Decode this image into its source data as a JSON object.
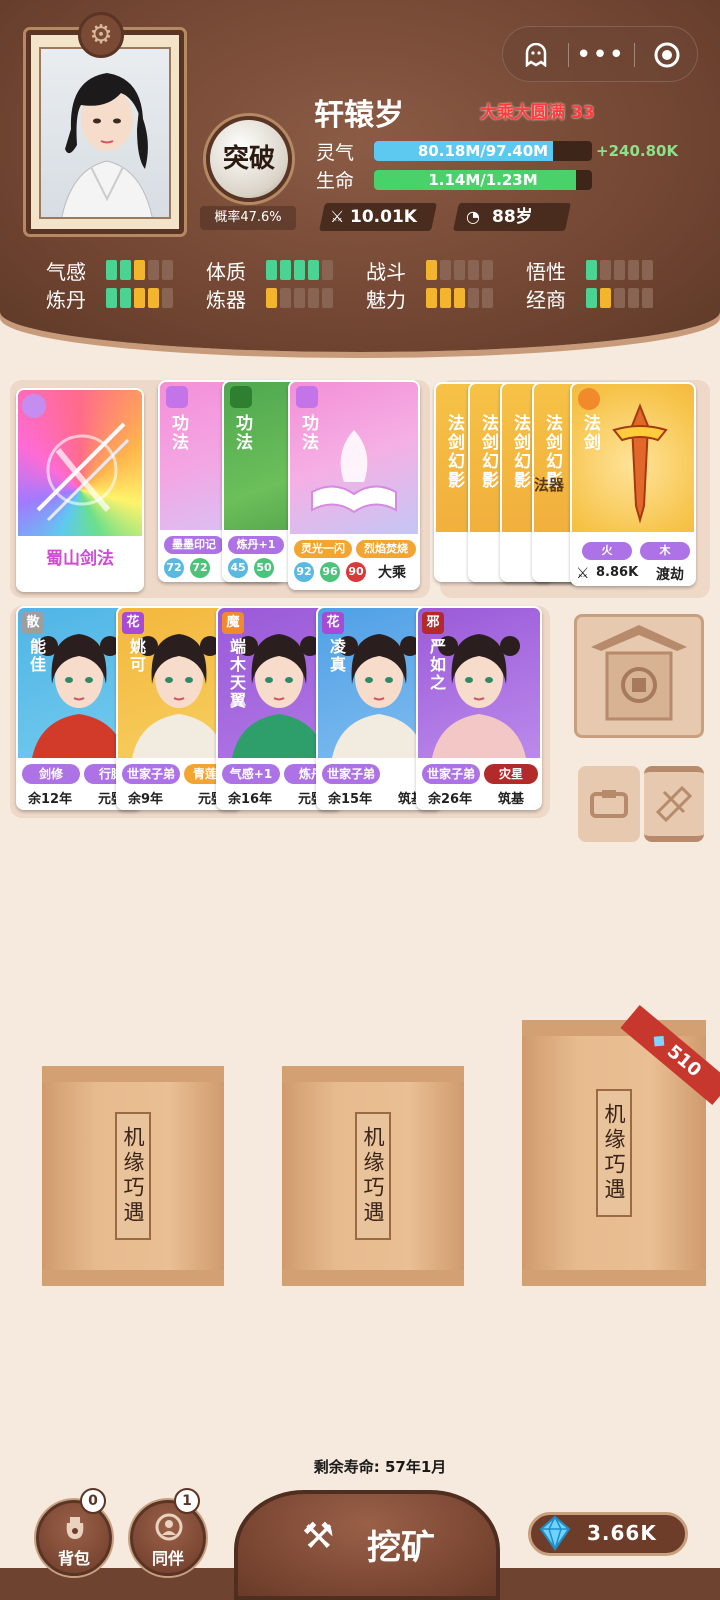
{
  "header": {
    "character_name": "轩辕岁",
    "realm": "大乘大圆满 33",
    "breakthrough_label": "突破",
    "breakthrough_rate": "概率47.6%",
    "qi": {
      "label": "灵气",
      "value": "80.18M/97.40M",
      "rate": "+240.80K",
      "fill": 0.823
    },
    "hp": {
      "label": "生命",
      "value": "1.14M/1.23M",
      "fill": 0.927
    },
    "power": "10.01K",
    "age": "88岁",
    "attributes": [
      {
        "label": "气感",
        "levels": [
          "#4bd394",
          "#4bd394",
          "#f4b52e",
          "#8a6452",
          "#8a6452"
        ]
      },
      {
        "label": "体质",
        "levels": [
          "#4bd394",
          "#4bd394",
          "#4bd394",
          "#4bd394",
          "#8a6452"
        ]
      },
      {
        "label": "战斗",
        "levels": [
          "#f4b52e",
          "#8a6452",
          "#8a6452",
          "#8a6452",
          "#8a6452"
        ]
      },
      {
        "label": "悟性",
        "levels": [
          "#4bd394",
          "#8a6452",
          "#8a6452",
          "#8a6452",
          "#8a6452"
        ]
      },
      {
        "label": "炼丹",
        "levels": [
          "#4bd394",
          "#4bd394",
          "#f4b52e",
          "#f4b52e",
          "#8a6452"
        ]
      },
      {
        "label": "炼器",
        "levels": [
          "#f4b52e",
          "#8a6452",
          "#8a6452",
          "#8a6452",
          "#8a6452"
        ]
      },
      {
        "label": "魅力",
        "levels": [
          "#f4b52e",
          "#f4b52e",
          "#f4b52e",
          "#8a6452",
          "#8a6452"
        ]
      },
      {
        "label": "经商",
        "levels": [
          "#4bd394",
          "#f4b52e",
          "#8a6452",
          "#8a6452",
          "#8a6452"
        ]
      }
    ]
  },
  "top_cards": {
    "sword_skill": {
      "name": "蜀山剑法"
    },
    "techniques": [
      {
        "type": "功法",
        "tag": "墨墨印记",
        "nums": [
          "72",
          "72"
        ]
      },
      {
        "type": "功法",
        "tag": "炼丹+1",
        "nums": [
          "45",
          "50"
        ]
      },
      {
        "type": "功法",
        "tag": "灵光一闪",
        "tag2": "烈焰焚烧",
        "nums": [
          "92",
          "96",
          "90"
        ],
        "realm": "大乘"
      }
    ],
    "artifacts": [
      {
        "type": "法剑幻影"
      },
      {
        "type": "法剑幻影"
      },
      {
        "type": "法剑幻影"
      },
      {
        "type": "法剑幻影",
        "overlay": "法器"
      },
      {
        "type": "法剑",
        "element1": "火",
        "element2": "木",
        "power": "8.86K",
        "stage": "渡劫"
      }
    ],
    "artifact_partial_power": "8",
    "artifact_partial_element": "火"
  },
  "companions": [
    {
      "badge": "散",
      "name": "能佳",
      "tag1": "剑修",
      "tag2": "行脚",
      "life": "余12年",
      "stage": "元婴"
    },
    {
      "badge": "花",
      "name": "姚可",
      "tag1": "世家子弟",
      "tag2": "青莲剑",
      "life": "余9年",
      "stage": "元婴"
    },
    {
      "badge": "魔",
      "name": "端木天翼",
      "tag1": "气感+1",
      "tag2": "炼丹",
      "life": "余16年",
      "stage": "元婴"
    },
    {
      "badge": "花",
      "name": "凌真",
      "tag1": "世家子弟",
      "life": "余15年",
      "stage": "筑基"
    },
    {
      "badge": "邪",
      "name": "严如之",
      "tag1": "世家子弟",
      "tag2": "灾星",
      "life": "余26年",
      "stage": "筑基"
    }
  ],
  "packs": [
    {
      "label": "机缘巧遇"
    },
    {
      "label": "机缘巧遇"
    },
    {
      "label": "机缘巧遇",
      "ribbon": "510"
    }
  ],
  "footer": {
    "lifespan": "剩余寿命: 57年1月",
    "bag": {
      "label": "背包",
      "count": "0"
    },
    "partner": {
      "label": "同伴",
      "count": "1"
    },
    "mine": "挖矿",
    "gems": "3.66K"
  },
  "colors": {
    "qi_bar": "#5ec9f0",
    "hp_bar": "#49d26a",
    "realm": "#ff3b3b"
  },
  "icons": [
    "gear-icon",
    "ghost-icon",
    "more-icon",
    "record-icon",
    "sword-power-icon",
    "age-icon",
    "bag-icon",
    "partner-icon",
    "pickaxe-icon",
    "gem-icon",
    "shrine-icon",
    "box-icon",
    "scroll-icon"
  ]
}
